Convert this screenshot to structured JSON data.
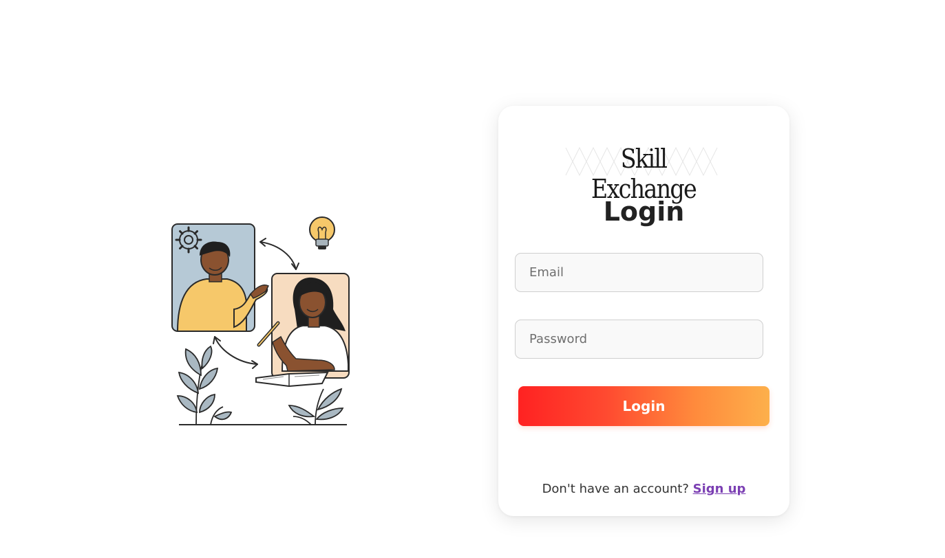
{
  "brand": {
    "name": "Skill Exchange"
  },
  "login_form": {
    "title": "Login",
    "email_placeholder": "Email",
    "password_placeholder": "Password",
    "submit_label": "Login"
  },
  "signup": {
    "prompt": "Don't have an account?",
    "link_label": "Sign up"
  },
  "illustration": {
    "icons": [
      "gear-icon",
      "lightbulb-icon",
      "swap-arrow-icon",
      "book-icon",
      "pencil-icon",
      "plant-icon"
    ]
  },
  "colors": {
    "button_gradient_start": "#ff2222",
    "button_gradient_end": "#fdb04b",
    "link": "#7b3fb3",
    "title": "#222222",
    "field_border": "#cfcfcf",
    "field_bg": "#f9f9f9"
  }
}
